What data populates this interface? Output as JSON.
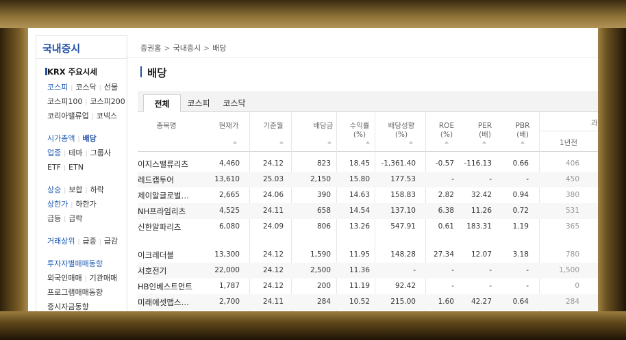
{
  "sidebar": {
    "title": "국내증시",
    "krx_head": "KRX 주요시세",
    "markets": [
      "코스피",
      "코스닥",
      "선물"
    ],
    "indices": [
      "코스피100",
      "코스피200"
    ],
    "value_row": [
      "코리아밸류업",
      "코넥스"
    ],
    "group1": [
      "시가총액",
      "배당"
    ],
    "group1b": [
      "업종",
      "테마",
      "그룹사"
    ],
    "group1c": [
      "ETF",
      "ETN"
    ],
    "group2": [
      "상승",
      "보합",
      "하락"
    ],
    "group2b": [
      "상한가",
      "하한가"
    ],
    "group2c": [
      "급등",
      "급락"
    ],
    "group3": [
      "거래상위",
      "급증",
      "급감"
    ],
    "group4_head": "투자자별매매동향",
    "group4": [
      "외국인매매",
      "기관매매"
    ],
    "group4b": "프로그램매매동향",
    "group4c": "증시자금동향"
  },
  "breadcrumb": [
    "증권홈",
    "국내증시",
    "배당"
  ],
  "page_title": "배당",
  "tabs": [
    "전체",
    "코스피",
    "코스닥"
  ],
  "columns": {
    "name": "종목명",
    "price": "현재가",
    "base_month": "기준월",
    "dividend": "배당금",
    "yield_1": "수익률",
    "yield_2": "(%)",
    "payout_1": "배당성향",
    "payout_2": "(%)",
    "roe_1": "ROE",
    "roe_2": "(%)",
    "per_1": "PER",
    "per_2": "(배)",
    "pbr_1": "PBR",
    "pbr_2": "(배)",
    "group_label": "과",
    "sub_label": "1년전"
  },
  "rows": [
    {
      "name": "이지스밸류리츠",
      "price": "4,460",
      "month": "24.12",
      "div": "823",
      "yield": "18.45",
      "payout": "-1,361.40",
      "roe": "-0.57",
      "per": "-116.13",
      "pbr": "0.66",
      "prev": "406"
    },
    {
      "name": "레드캡투어",
      "price": "13,610",
      "month": "25.03",
      "div": "2,150",
      "yield": "15.80",
      "payout": "177.53",
      "roe": "-",
      "per": "-",
      "pbr": "-",
      "prev": "450"
    },
    {
      "name": "제이알글로벌…",
      "price": "2,665",
      "month": "24.06",
      "div": "390",
      "yield": "14.63",
      "payout": "158.83",
      "roe": "2.82",
      "per": "32.42",
      "pbr": "0.94",
      "prev": "380"
    },
    {
      "name": "NH프라임리츠",
      "price": "4,525",
      "month": "24.11",
      "div": "658",
      "yield": "14.54",
      "payout": "137.10",
      "roe": "6.38",
      "per": "11.26",
      "pbr": "0.72",
      "prev": "531"
    },
    {
      "name": "신한알파리츠",
      "price": "6,080",
      "month": "24.09",
      "div": "806",
      "yield": "13.26",
      "payout": "547.91",
      "roe": "0.61",
      "per": "183.31",
      "pbr": "1.19",
      "prev": "365"
    },
    {
      "name": "이크레더블",
      "price": "13,300",
      "month": "24.12",
      "div": "1,590",
      "yield": "11.95",
      "payout": "148.28",
      "roe": "27.34",
      "per": "12.07",
      "pbr": "3.18",
      "prev": "780"
    },
    {
      "name": "서호전기",
      "price": "22,000",
      "month": "24.12",
      "div": "2,500",
      "yield": "11.36",
      "payout": "-",
      "roe": "-",
      "per": "-",
      "pbr": "-",
      "prev": "1,500"
    },
    {
      "name": "HB인베스트먼트",
      "price": "1,787",
      "month": "24.12",
      "div": "200",
      "yield": "11.19",
      "payout": "92.42",
      "roe": "-",
      "per": "-",
      "pbr": "-",
      "prev": "0"
    },
    {
      "name": "미래에셋맵스…",
      "price": "2,700",
      "month": "24.11",
      "div": "284",
      "yield": "10.52",
      "payout": "215.00",
      "roe": "1.60",
      "per": "42.27",
      "pbr": "0.64",
      "prev": "284"
    }
  ]
}
